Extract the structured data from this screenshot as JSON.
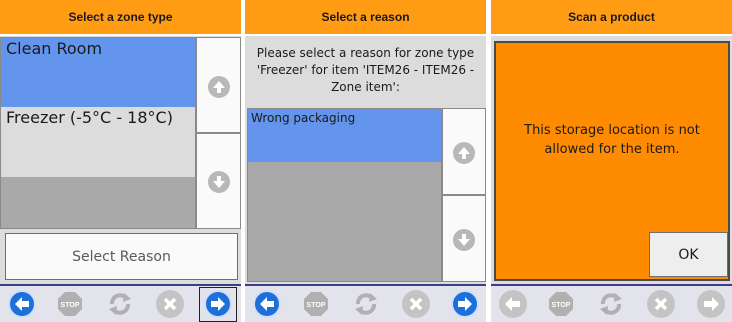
{
  "panels": [
    {
      "title": "Select a zone type",
      "list": [
        "Clean Room",
        "Freezer (-5°C - 18°C)"
      ],
      "action_button": "Select Reason"
    },
    {
      "title": "Select a reason",
      "prompt": "Please select a reason for zone type 'Freezer' for item 'ITEM26 - ITEM26 - Zone item':",
      "list": [
        "Wrong packaging"
      ]
    },
    {
      "title": "Scan a product",
      "message": "This storage location is not allowed for the item.",
      "ok_button": "OK"
    }
  ],
  "toolbar_icons": [
    "back-arrow-icon",
    "stop-icon",
    "refresh-icon",
    "cancel-icon",
    "forward-arrow-icon"
  ],
  "toolbar_stop_label": "STOP",
  "colors": {
    "header": "#ff9c14",
    "selected": "#6495ed",
    "alert_bg": "#ff8c00",
    "arrow_blue": "#1e6fd9",
    "toolbar_border": "#3d3d8a"
  }
}
